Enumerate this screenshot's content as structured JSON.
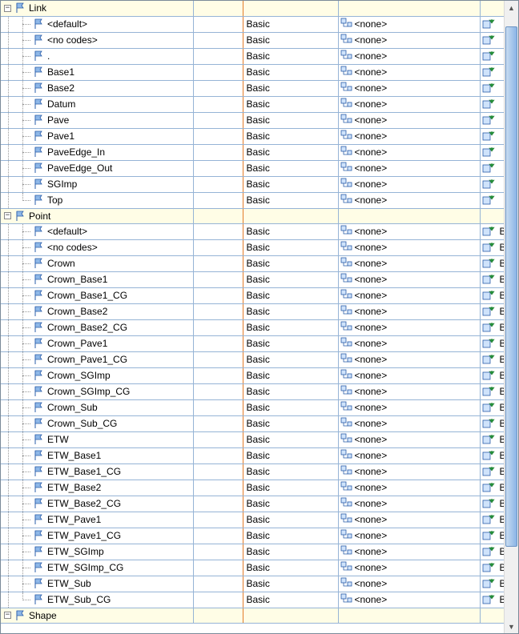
{
  "symbols": {
    "expand_minus": "−",
    "expand_plus": "+",
    "scroll_up": "▲",
    "scroll_down": "▼"
  },
  "categories": [
    {
      "name": "Link",
      "expanded": true,
      "show_extra_b": false,
      "rows": [
        {
          "name": "<default>",
          "style": "Basic",
          "label": "<none>"
        },
        {
          "name": "<no codes>",
          "style": "Basic",
          "label": "<none>"
        },
        {
          "name": ".",
          "style": "Basic",
          "label": "<none>"
        },
        {
          "name": "Base1",
          "style": "Basic",
          "label": "<none>"
        },
        {
          "name": "Base2",
          "style": "Basic",
          "label": "<none>"
        },
        {
          "name": "Datum",
          "style": "Basic",
          "label": "<none>"
        },
        {
          "name": "Pave",
          "style": "Basic",
          "label": "<none>"
        },
        {
          "name": "Pave1",
          "style": "Basic",
          "label": "<none>"
        },
        {
          "name": "PaveEdge_In",
          "style": "Basic",
          "label": "<none>"
        },
        {
          "name": "PaveEdge_Out",
          "style": "Basic",
          "label": "<none>"
        },
        {
          "name": "SGImp",
          "style": "Basic",
          "label": "<none>"
        },
        {
          "name": "Top",
          "style": "Basic",
          "label": "<none>"
        }
      ]
    },
    {
      "name": "Point",
      "expanded": true,
      "show_extra_b": true,
      "rows": [
        {
          "name": "<default>",
          "style": "Basic",
          "label": "<none>"
        },
        {
          "name": "<no codes>",
          "style": "Basic",
          "label": "<none>"
        },
        {
          "name": "Crown",
          "style": "Basic",
          "label": "<none>"
        },
        {
          "name": "Crown_Base1",
          "style": "Basic",
          "label": "<none>"
        },
        {
          "name": "Crown_Base1_CG",
          "style": "Basic",
          "label": "<none>"
        },
        {
          "name": "Crown_Base2",
          "style": "Basic",
          "label": "<none>"
        },
        {
          "name": "Crown_Base2_CG",
          "style": "Basic",
          "label": "<none>"
        },
        {
          "name": "Crown_Pave1",
          "style": "Basic",
          "label": "<none>"
        },
        {
          "name": "Crown_Pave1_CG",
          "style": "Basic",
          "label": "<none>"
        },
        {
          "name": "Crown_SGImp",
          "style": "Basic",
          "label": "<none>"
        },
        {
          "name": "Crown_SGImp_CG",
          "style": "Basic",
          "label": "<none>"
        },
        {
          "name": "Crown_Sub",
          "style": "Basic",
          "label": "<none>"
        },
        {
          "name": "Crown_Sub_CG",
          "style": "Basic",
          "label": "<none>"
        },
        {
          "name": "ETW",
          "style": "Basic",
          "label": "<none>"
        },
        {
          "name": "ETW_Base1",
          "style": "Basic",
          "label": "<none>"
        },
        {
          "name": "ETW_Base1_CG",
          "style": "Basic",
          "label": "<none>"
        },
        {
          "name": "ETW_Base2",
          "style": "Basic",
          "label": "<none>"
        },
        {
          "name": "ETW_Base2_CG",
          "style": "Basic",
          "label": "<none>"
        },
        {
          "name": "ETW_Pave1",
          "style": "Basic",
          "label": "<none>"
        },
        {
          "name": "ETW_Pave1_CG",
          "style": "Basic",
          "label": "<none>"
        },
        {
          "name": "ETW_SGImp",
          "style": "Basic",
          "label": "<none>"
        },
        {
          "name": "ETW_SGImp_CG",
          "style": "Basic",
          "label": "<none>"
        },
        {
          "name": "ETW_Sub",
          "style": "Basic",
          "label": "<none>"
        },
        {
          "name": "ETW_Sub_CG",
          "style": "Basic",
          "label": "<none>"
        }
      ]
    },
    {
      "name": "Shape",
      "expanded": true,
      "show_extra_b": false,
      "rows": []
    }
  ],
  "extra_b_text": "B",
  "scrollbar": {
    "thumb_top_pct": 2,
    "thumb_height_pct": 86
  }
}
